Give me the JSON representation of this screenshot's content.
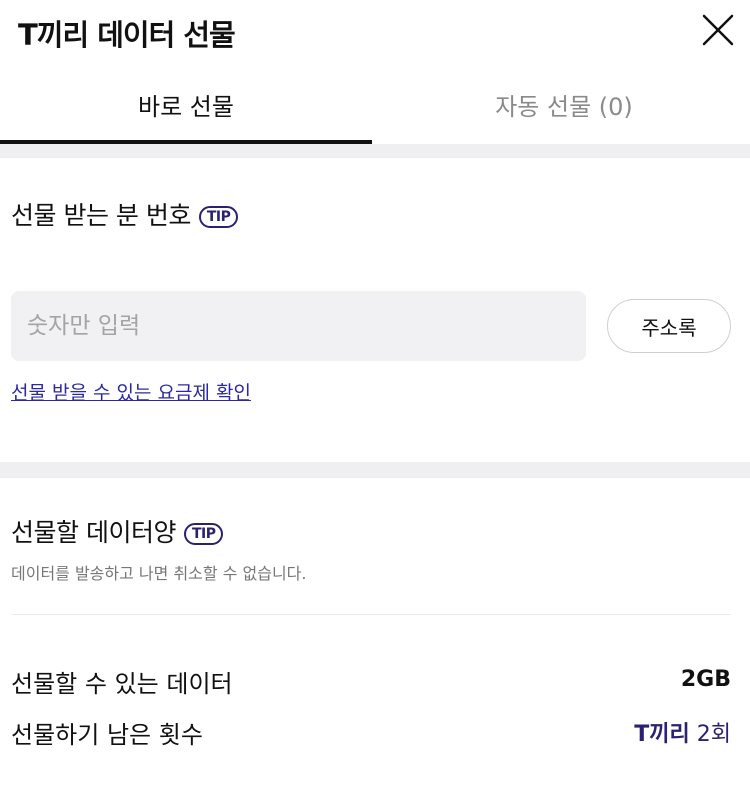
{
  "header": {
    "title": "T끼리 데이터 선물",
    "close_icon": "close-icon"
  },
  "tabs": [
    {
      "label": "바로 선물",
      "active": true
    },
    {
      "label": "자동 선물 (0)",
      "active": false
    }
  ],
  "recipient": {
    "label": "선물 받는 분 번호",
    "tip": "TIP",
    "input_placeholder": "숫자만 입력",
    "input_value": "",
    "address_book_button": "주소록",
    "plan_link": "선물 받을 수 있는 요금제 확인"
  },
  "amount": {
    "label": "선물할 데이터양",
    "tip": "TIP",
    "description": "데이터를 발송하고 나면 취소할 수 없습니다.",
    "available_label": "선물할 수 있는 데이터",
    "available_value": "2GB",
    "remaining_label": "선물하기 남은 횟수",
    "remaining_prefix": "T끼리",
    "remaining_value": "2회"
  },
  "colors": {
    "accent": "#2b2170",
    "link": "#2c2aa0",
    "band": "#efeff1",
    "text": "#111111"
  }
}
